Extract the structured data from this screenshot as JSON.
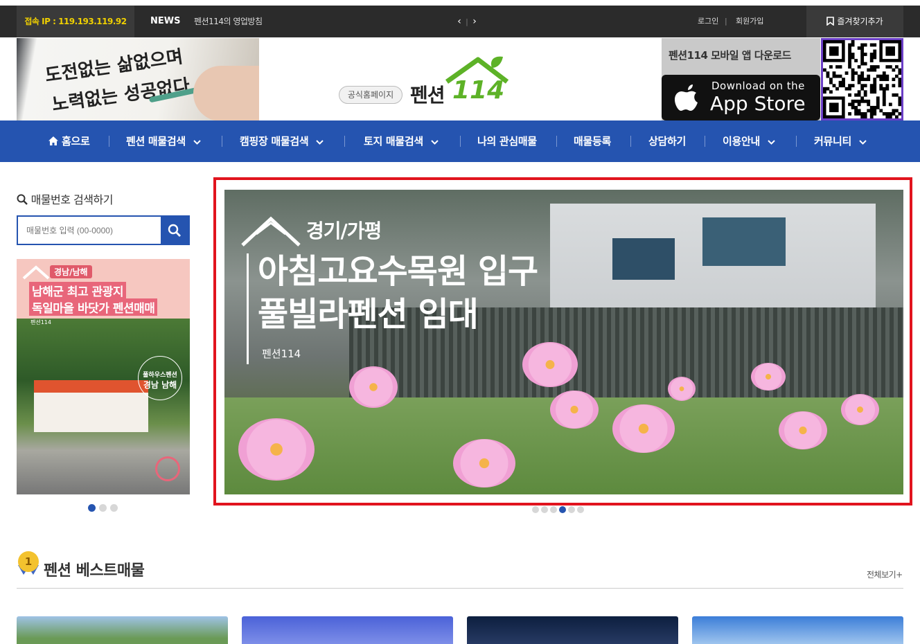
{
  "topbar": {
    "ip_text": "접속 IP : 119.193.119.92",
    "news_label": "NEWS",
    "news_text": "펜션114의 영업방침",
    "prev_arrow": "‹",
    "next_arrow": "›",
    "login": "로그인",
    "signup": "회원가입",
    "bookmark": "즐겨찾기추가"
  },
  "header": {
    "official_badge": "공식홈페이지",
    "logo_text": "펜션",
    "logo_number": "114",
    "app_title": "펜션114 모바일 앱 다운로드",
    "app_store_small": "Download on the",
    "app_store_big": "App Store",
    "banner_calligraphy_1": "도전없는 삶없으며",
    "banner_calligraphy_2": "노력없는 성공없다"
  },
  "nav": {
    "items": [
      {
        "label": "홈으로",
        "icon": "home-icon",
        "dropdown": false
      },
      {
        "label": "펜션 매물검색",
        "dropdown": true
      },
      {
        "label": "캠핑장 매물검색",
        "dropdown": true
      },
      {
        "label": "토지 매물검색",
        "dropdown": true
      },
      {
        "label": "나의 관심매물",
        "dropdown": false
      },
      {
        "label": "매물등록",
        "dropdown": false
      },
      {
        "label": "상담하기",
        "dropdown": false
      },
      {
        "label": "이용안내",
        "dropdown": true
      },
      {
        "label": "커뮤니티",
        "dropdown": true
      }
    ]
  },
  "sidebar": {
    "search_title": "매물번호 검색하기",
    "search_placeholder": "매물번호 입력 (00-0000)",
    "ad": {
      "badge": "경남/남해",
      "line1": "남해군 최고 관광지",
      "line2": "독일마을 바닷가 펜션매매",
      "brand": "펜션114",
      "circle_line1": "풀하우스펜션",
      "circle_line2": "경남 남해"
    },
    "dots": {
      "count": 3,
      "active": 0
    }
  },
  "main_banner": {
    "region": "경기/가평",
    "headline1": "아침고요수목원 입구",
    "headline2": "풀빌라펜션 임대",
    "brand": "펜션114",
    "dots": {
      "count": 6,
      "active": 3
    }
  },
  "best": {
    "medal": "1",
    "title": "펜션 베스트매물",
    "see_all": "전체보기+"
  },
  "colors": {
    "nav_blue": "#2554b0",
    "highlight_red": "#e1141e",
    "ip_yellow": "#f0d000",
    "logo_green": "#5db227"
  }
}
